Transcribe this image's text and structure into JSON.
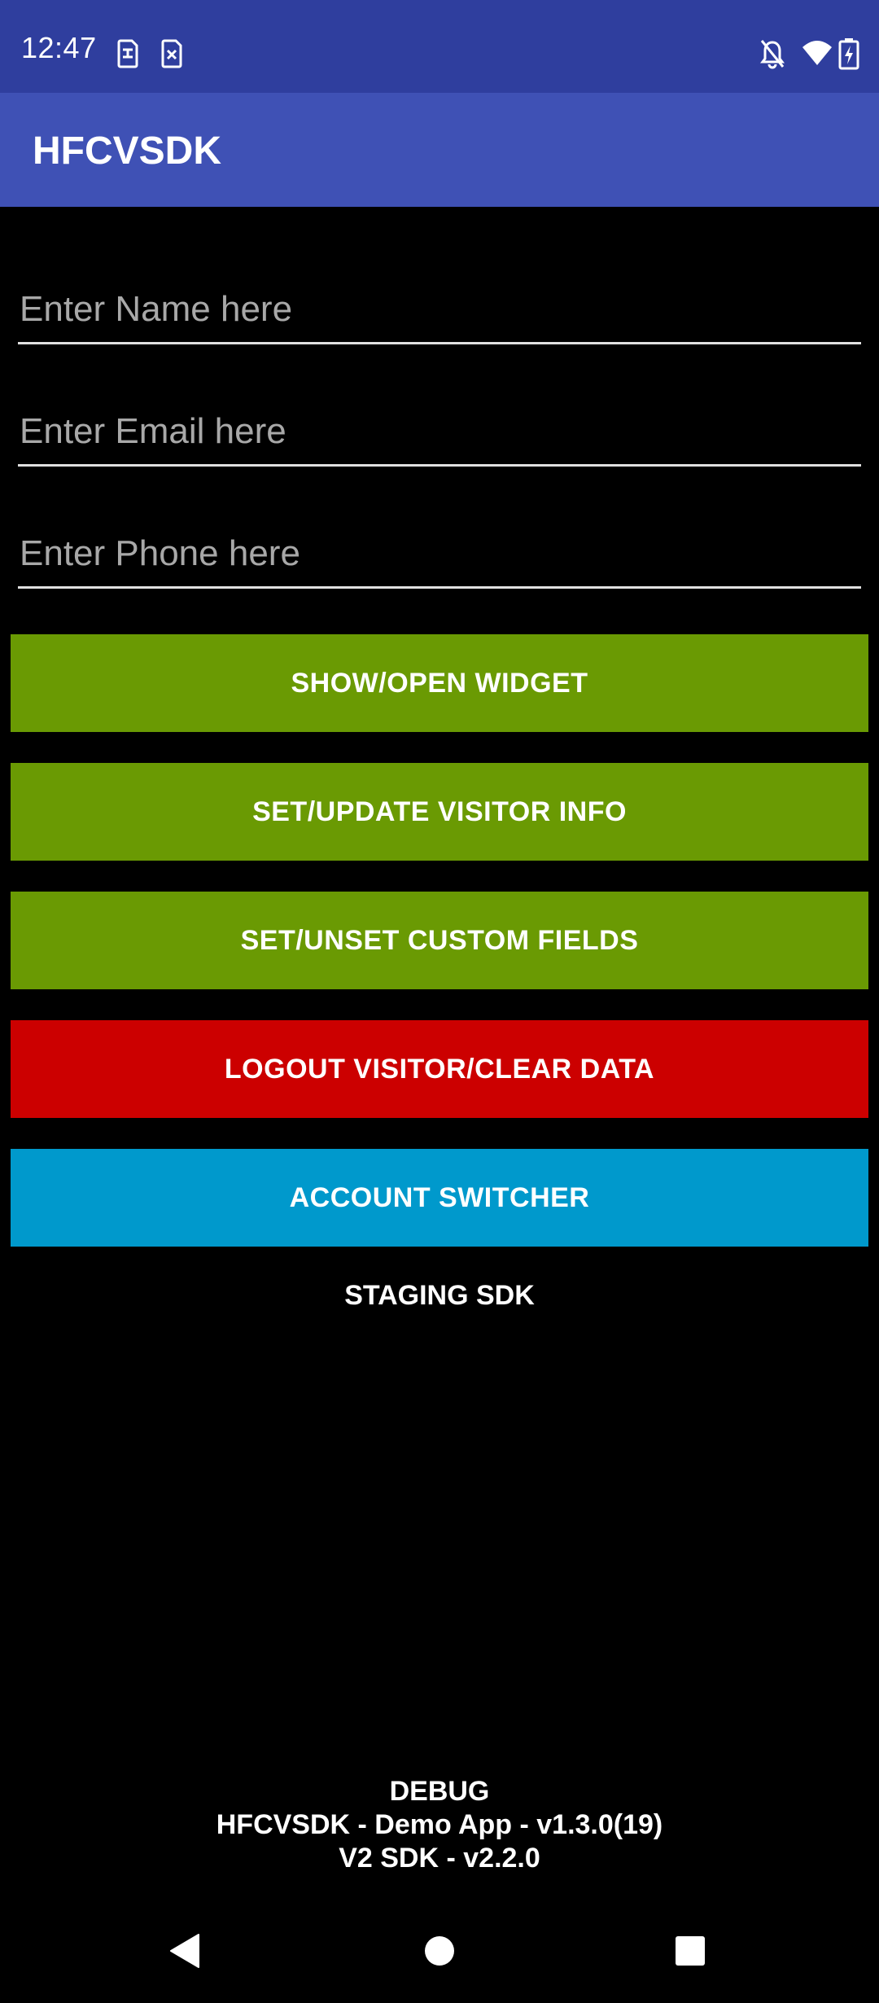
{
  "status_bar": {
    "time": "12:47",
    "left_icons": [
      "sim-card-icon",
      "sim-card-off-icon"
    ],
    "right_icons": [
      "notifications-off-icon",
      "wifi-icon",
      "battery-charging-icon"
    ],
    "background_color": "#2f3e9e"
  },
  "app_bar": {
    "title": "HFCVSDK",
    "background_color": "#3f51b5"
  },
  "form": {
    "name_placeholder": "Enter Name here",
    "name_value": "",
    "email_placeholder": "Enter Email here",
    "email_value": "",
    "phone_placeholder": "Enter Phone here",
    "phone_value": ""
  },
  "buttons": {
    "show_widget": {
      "label": "SHOW/OPEN WIDGET",
      "color": "#6a9a03"
    },
    "set_visitor_info": {
      "label": "SET/UPDATE VISITOR INFO",
      "color": "#6a9a03"
    },
    "custom_fields": {
      "label": "SET/UNSET CUSTOM FIELDS",
      "color": "#6a9a03"
    },
    "logout": {
      "label": "LOGOUT VISITOR/CLEAR DATA",
      "color": "#cc0000"
    },
    "account_switcher": {
      "label": "ACCOUNT SWITCHER",
      "color": "#0099cc"
    }
  },
  "staging_label": "STAGING SDK",
  "footer": {
    "build_type": "DEBUG",
    "app_version": "HFCVSDK - Demo App - v1.3.0(19)",
    "sdk_version": "V2 SDK - v2.2.0"
  },
  "nav_bar": {
    "icons": [
      "back-icon",
      "home-icon",
      "recents-icon"
    ]
  }
}
